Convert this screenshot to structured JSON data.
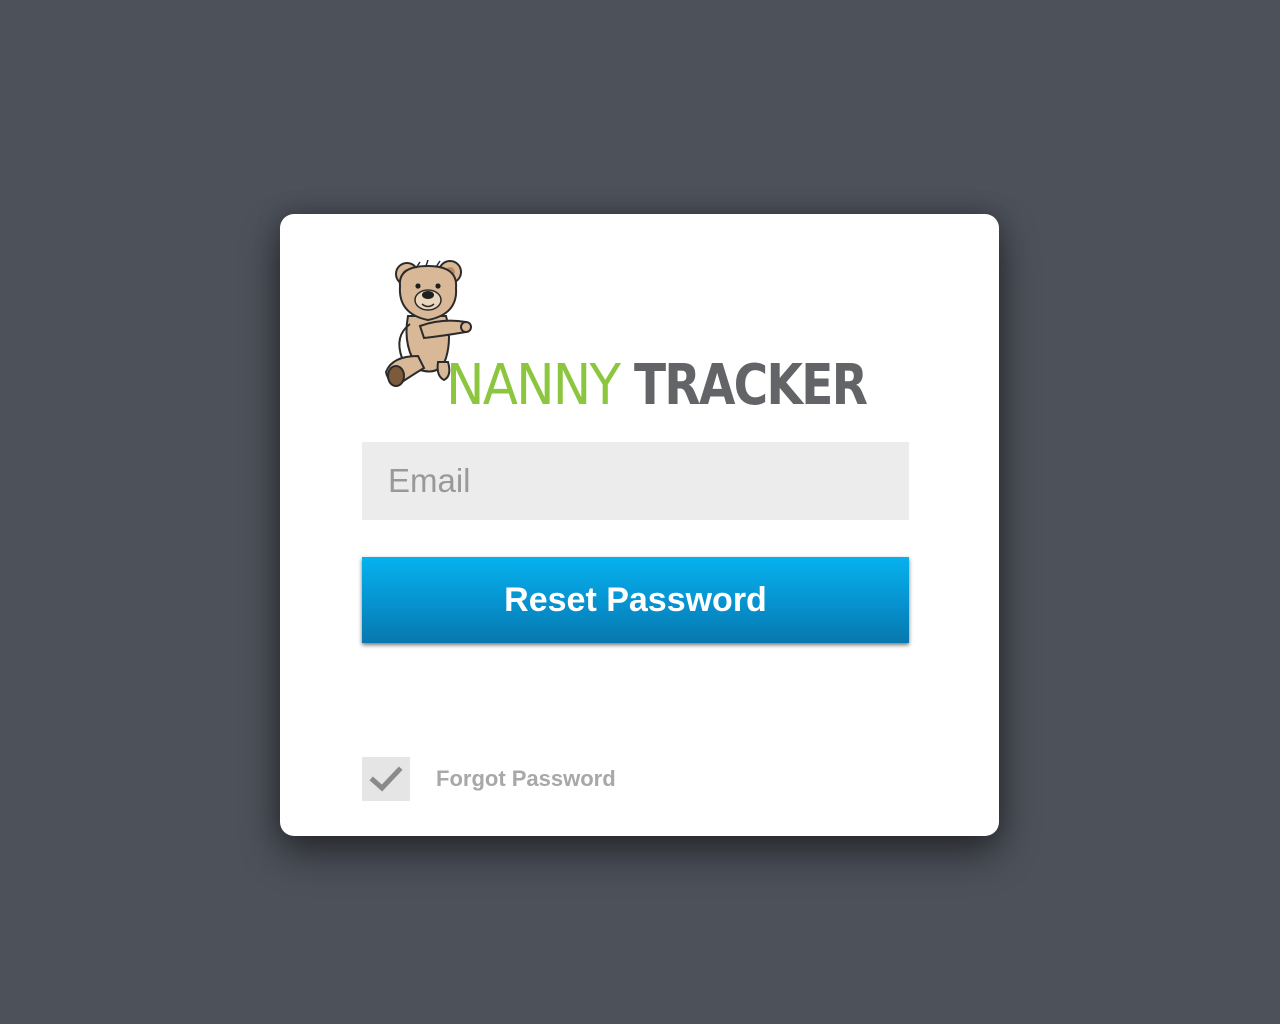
{
  "logo": {
    "word_one": "NANNY",
    "word_two": "TRACKER",
    "word_one_color": "#8cc63f",
    "word_two_color": "#636467",
    "mascot": "teddy-bear-icon"
  },
  "form": {
    "email_placeholder": "Email",
    "email_value": "",
    "submit_label": "Reset Password",
    "submit_color": "#0693d1"
  },
  "footer": {
    "forgot_label": "Forgot Password",
    "forgot_icon": "checkmark-icon"
  },
  "colors": {
    "background": "#4d515a",
    "card": "#ffffff",
    "input_bg": "#ececec"
  }
}
